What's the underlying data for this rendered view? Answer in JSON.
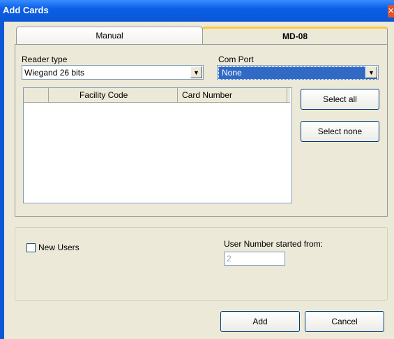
{
  "window": {
    "title": "Add Cards",
    "close_glyph": "✕"
  },
  "tabs": [
    {
      "label": "Manual"
    },
    {
      "label": "MD-08"
    }
  ],
  "reader_type": {
    "label": "Reader type",
    "value": "Wiegand 26 bits"
  },
  "com_port": {
    "label": "Com Port",
    "value": "None"
  },
  "card_list": {
    "columns": [
      "",
      "Facility Code",
      "Card Number"
    ],
    "rows": []
  },
  "buttons": {
    "select_all": "Select all",
    "select_none": "Select none",
    "add": "Add",
    "cancel": "Cancel"
  },
  "new_users": {
    "label": "New Users",
    "checked": false
  },
  "user_number": {
    "label": "User Number started from:",
    "value": "2"
  },
  "colors": {
    "titlebar": "#0b57d6",
    "dialog_bg": "#ece9d8",
    "selection": "#316ac5",
    "active_tab_accent": "#ffc73c"
  },
  "icons": {
    "dropdown": "chevron-down-icon",
    "close": "close-icon"
  }
}
